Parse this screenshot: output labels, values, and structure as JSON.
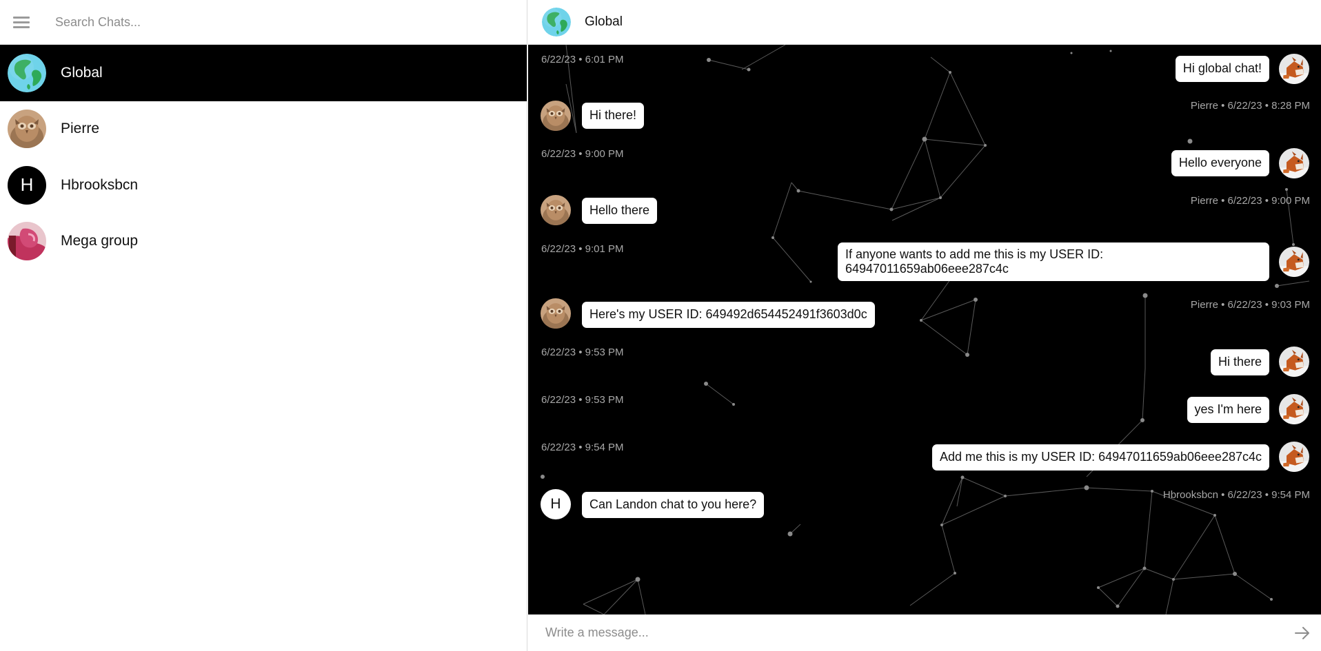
{
  "sidebar": {
    "search": {
      "placeholder": "Search Chats..."
    },
    "chats": [
      {
        "name": "Global",
        "avatar": "globe-icon",
        "active": true
      },
      {
        "name": "Pierre",
        "avatar": "owl-photo"
      },
      {
        "name": "Hbrooksbcn",
        "avatar": "letter",
        "letter": "H"
      },
      {
        "name": "Mega group",
        "avatar": "pink-photo"
      }
    ]
  },
  "chat": {
    "title": "Global",
    "messages": [
      {
        "side": "right",
        "text": "Hi global chat!",
        "meta": "6/22/23 • 6:01 PM",
        "avatar": "fox-photo"
      },
      {
        "side": "left",
        "text": "Hi there!",
        "meta": "Pierre • 6/22/23 • 8:28 PM",
        "avatar": "owl-photo"
      },
      {
        "side": "right",
        "text": "Hello everyone",
        "meta": "6/22/23 • 9:00 PM",
        "avatar": "fox-photo"
      },
      {
        "side": "left",
        "text": "Hello there",
        "meta": "Pierre • 6/22/23 • 9:00 PM",
        "avatar": "owl-photo"
      },
      {
        "side": "right",
        "text": "If anyone wants to add me this is my USER ID: 64947011659ab06eee287c4c",
        "meta": "6/22/23 • 9:01 PM",
        "avatar": "fox-photo"
      },
      {
        "side": "left",
        "text": "Here's my USER ID: 649492d654452491f3603d0c",
        "meta": "Pierre • 6/22/23 • 9:03 PM",
        "avatar": "owl-photo"
      },
      {
        "side": "right",
        "text": "Hi there",
        "meta": "6/22/23 • 9:53 PM",
        "avatar": "fox-photo"
      },
      {
        "side": "right",
        "text": "yes I'm here",
        "meta": "6/22/23 • 9:53 PM",
        "avatar": "fox-photo"
      },
      {
        "side": "right",
        "text": "Add me this is my USER ID: 64947011659ab06eee287c4c",
        "meta": "6/22/23 • 9:54 PM",
        "avatar": "fox-photo"
      },
      {
        "side": "left",
        "text": "Can Landon chat to you here?",
        "meta": "Hbrooksbcn • 6/22/23 • 9:54 PM",
        "avatar": "letter",
        "letter": "H"
      }
    ]
  },
  "composer": {
    "placeholder": "Write a message...",
    "send_icon": "arrow-right-icon"
  },
  "colors": {
    "active_chat_bg": "#000000",
    "messages_bg": "#000000",
    "bubble_bg": "#ffffff",
    "meta_text": "#a8a8a8"
  }
}
